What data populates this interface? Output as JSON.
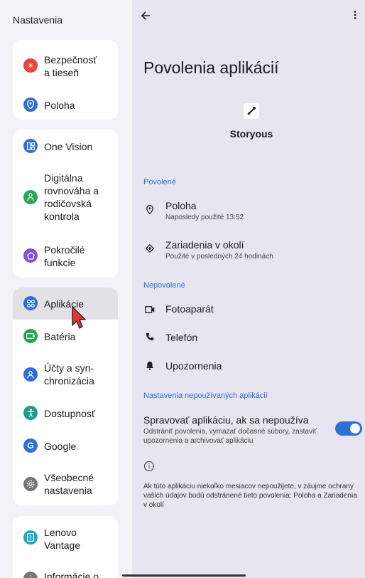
{
  "sidebar": {
    "title": "Nastavenia",
    "groups": [
      {
        "items": [
          {
            "label": "Bezpečnosť\na tieseň",
            "icon": "asterisk-icon",
            "color": "#e8453c"
          },
          {
            "label": "Poloha",
            "icon": "location-icon",
            "color": "#2f6fd6"
          }
        ]
      },
      {
        "items": [
          {
            "label": "One Vision",
            "icon": "one-vision-icon",
            "color": "#2f6fd6"
          },
          {
            "label": "Digitálna rovnováha a rodičovská kontrola",
            "icon": "wellbeing-icon",
            "color": "#2aa55a"
          },
          {
            "label": "Pokročilé funkcie",
            "icon": "advanced-icon",
            "color": "#7b55d6"
          }
        ]
      },
      {
        "items": [
          {
            "label": "Aplikácie",
            "icon": "apps-icon",
            "color": "#2f6fd6",
            "selected": true
          },
          {
            "label": "Batéria",
            "icon": "battery-icon",
            "color": "#2aa55a"
          },
          {
            "label": "Účty a syn-\nchronizácia",
            "icon": "account-icon",
            "color": "#2f6fd6"
          },
          {
            "label": "Dostupnosť",
            "icon": "accessibility-icon",
            "color": "#1a9e8a"
          },
          {
            "label": "Google",
            "icon": "google-icon",
            "color": "#2f6fd6"
          },
          {
            "label": "Všeobecné\nnastavenia",
            "icon": "gear-icon",
            "color": "#777777"
          }
        ]
      },
      {
        "items": [
          {
            "label": "Lenovo\nVantage",
            "icon": "vantage-icon",
            "color": "#1aa8c4"
          },
          {
            "label": "Informácie o",
            "icon": "info-icon",
            "color": "#777777"
          }
        ]
      }
    ]
  },
  "header": {
    "title": "Povolenia aplikácií"
  },
  "app": {
    "name": "Storyous"
  },
  "allowed": {
    "header": "Povolené",
    "items": [
      {
        "title": "Poloha",
        "subtitle": "Naposledy použité 13:52",
        "icon": "location-pin-icon"
      },
      {
        "title": "Zariadenia v okolí",
        "subtitle": "Použité v posledných 24 hodinách",
        "icon": "nearby-devices-icon"
      }
    ]
  },
  "denied": {
    "header": "Nepovolené",
    "items": [
      {
        "title": "Fotoaparát",
        "icon": "camera-icon"
      },
      {
        "title": "Telefón",
        "icon": "phone-icon"
      },
      {
        "title": "Upozornenia",
        "icon": "bell-icon"
      }
    ]
  },
  "unused": {
    "header": "Nastavenia nepoužívaných aplikácií",
    "toggle_title": "Spravovať aplikáciu, ak sa nepoužíva",
    "toggle_subtitle": "Odstrániť povolenia, vymazať dočasné súbory, zastaviť upozornenia a archivovať aplikáciu",
    "toggle_on": true,
    "info_text": "Ak túto aplikáciu niekoľko mesiacov nepoužijete, v záujme ochrany vašich údajov budú odstránené tieto povolenia: Poloha a Zariadenia v okolí"
  },
  "colors": {
    "accent": "#2f6fd6"
  }
}
